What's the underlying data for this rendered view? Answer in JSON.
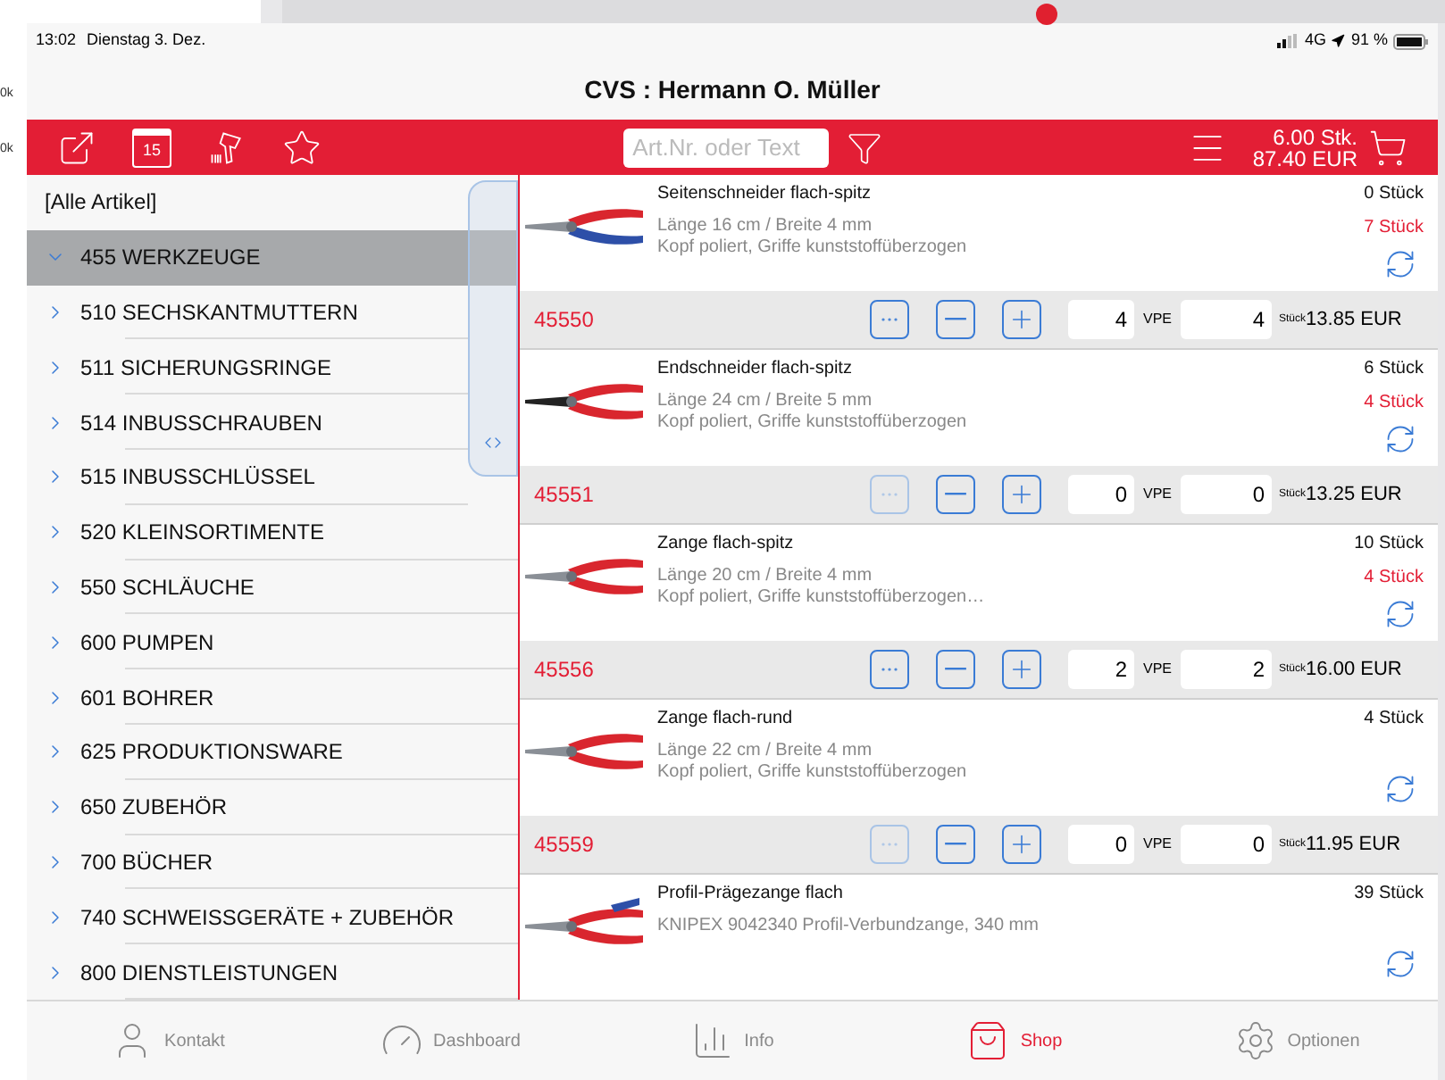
{
  "backdrop": {
    "labels": [
      "0k",
      "0k"
    ]
  },
  "status_bar": {
    "time": "13:02",
    "date": "Dienstag 3. Dez.",
    "network": "4G",
    "battery": "91 %"
  },
  "title": "CVS : Hermann O. Müller",
  "toolbar": {
    "calendar_day": "15",
    "search": {
      "placeholder": "Art.Nr. oder Text"
    },
    "cart": {
      "quantity": "6.00 Stk.",
      "total": "87.40 EUR"
    }
  },
  "sidebar": {
    "items": [
      {
        "label": "[Alle Artikel]",
        "kind": "plain",
        "selected": false
      },
      {
        "label": "455 WERKZEUGE",
        "kind": "group",
        "selected": true,
        "expanded": true
      },
      {
        "label": "510 SECHSKANTMUTTERN",
        "kind": "group",
        "selected": false,
        "expanded": false
      },
      {
        "label": "511 SICHERUNGSRINGE",
        "kind": "group",
        "selected": false,
        "expanded": false
      },
      {
        "label": "514 INBUSSCHRAUBEN",
        "kind": "group",
        "selected": false,
        "expanded": false
      },
      {
        "label": "515 INBUSSCHLÜSSEL",
        "kind": "group",
        "selected": false,
        "expanded": false
      },
      {
        "label": "520 KLEINSORTIMENTE",
        "kind": "group",
        "selected": false,
        "expanded": false
      },
      {
        "label": "550 SCHLÄUCHE",
        "kind": "group",
        "selected": false,
        "expanded": false
      },
      {
        "label": "600 PUMPEN",
        "kind": "group",
        "selected": false,
        "expanded": false
      },
      {
        "label": "601 BOHRER",
        "kind": "group",
        "selected": false,
        "expanded": false
      },
      {
        "label": "625 PRODUKTIONSWARE",
        "kind": "group",
        "selected": false,
        "expanded": false
      },
      {
        "label": "650 ZUBEHÖR",
        "kind": "group",
        "selected": false,
        "expanded": false
      },
      {
        "label": "700 BÜCHER",
        "kind": "group",
        "selected": false,
        "expanded": false
      },
      {
        "label": "740 SCHWEISSGERÄTE + ZUBEHÖR",
        "kind": "group",
        "selected": false,
        "expanded": false
      },
      {
        "label": "800 DIENSTLEISTUNGEN",
        "kind": "group",
        "selected": false,
        "expanded": false
      }
    ]
  },
  "products": [
    {
      "name": "Seitenschneider flach-spitz",
      "details": [
        "Länge 16 cm / Breite 4 mm",
        "Kopf poliert, Griffe kunststoffüberzogen"
      ],
      "stock": "0 Stück",
      "ordered": "7 Stück",
      "number": "45550",
      "more_disabled": false,
      "quantity": "4",
      "vpe_label": "VPE",
      "vpe": "4",
      "unit": "Stück",
      "price": "13.85 EUR"
    },
    {
      "name": "Endschneider flach-spitz",
      "details": [
        "Länge 24 cm / Breite 5 mm",
        "Kopf poliert, Griffe kunststoffüberzogen"
      ],
      "stock": "6 Stück",
      "ordered": "4 Stück",
      "number": "45551",
      "more_disabled": true,
      "quantity": "0",
      "vpe_label": "VPE",
      "vpe": "0",
      "unit": "Stück",
      "price": "13.25 EUR"
    },
    {
      "name": "Zange flach-spitz",
      "details": [
        "Länge 20 cm / Breite 4 mm",
        "Kopf poliert, Griffe kunststoffüberzogen…"
      ],
      "stock": "10 Stück",
      "ordered": "4 Stück",
      "number": "45556",
      "more_disabled": false,
      "quantity": "2",
      "vpe_label": "VPE",
      "vpe": "2",
      "unit": "Stück",
      "price": "16.00 EUR"
    },
    {
      "name": "Zange flach-rund",
      "details": [
        "Länge 22 cm / Breite 4 mm",
        "Kopf poliert, Griffe kunststoffüberzogen"
      ],
      "stock": "4 Stück",
      "number": "45559",
      "more_disabled": true,
      "quantity": "0",
      "vpe_label": "VPE",
      "vpe": "0",
      "unit": "Stück",
      "price": "11.95 EUR"
    },
    {
      "name": "Profil-Prägezange flach",
      "details": [
        "KNIPEX 9042340 Profil-Verbundzange, 340 mm"
      ],
      "stock": "39 Stück"
    }
  ],
  "tabs": [
    {
      "label": "Kontakt",
      "selected": false
    },
    {
      "label": "Dashboard",
      "selected": false
    },
    {
      "label": "Info",
      "selected": false
    },
    {
      "label": "Shop",
      "selected": true
    },
    {
      "label": "Optionen",
      "selected": false
    }
  ]
}
